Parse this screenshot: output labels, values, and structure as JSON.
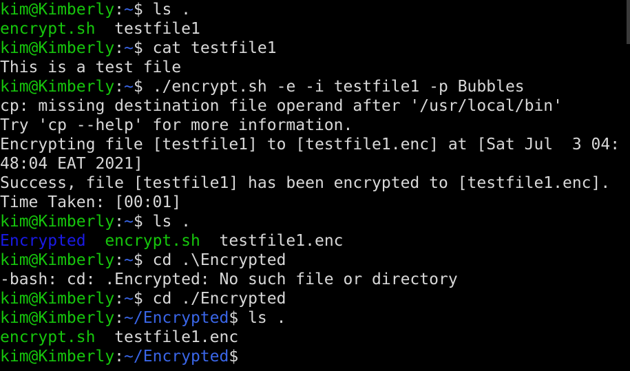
{
  "terminal": {
    "colors": {
      "background": "#000000",
      "text": "#d8d8d8",
      "prompt_user": "#16c60c",
      "prompt_path": "#3a66e8",
      "directory": "#1a1ae6",
      "executable": "#16c60c"
    },
    "prompt": {
      "userhost": "kim@Kimberly",
      "colon": ":",
      "home": "~",
      "subdir": "~/Encrypted",
      "symbol": "$"
    },
    "lines": [
      {
        "type": "prompt",
        "path": "~",
        "cmd": " ls ."
      },
      {
        "type": "listing",
        "items": [
          {
            "text": "encrypt.sh",
            "kind": "exec"
          },
          {
            "text": "  testfile1",
            "kind": "file"
          }
        ]
      },
      {
        "type": "prompt",
        "path": "~",
        "cmd": " cat testfile1"
      },
      {
        "type": "output",
        "text": "This is a test file"
      },
      {
        "type": "prompt",
        "path": "~",
        "cmd": " ./encrypt.sh -e -i testfile1 -p Bubbles"
      },
      {
        "type": "output",
        "text": "cp: missing destination file operand after '/usr/local/bin'"
      },
      {
        "type": "output",
        "text": "Try 'cp --help' for more information."
      },
      {
        "type": "output",
        "text": "Encrypting file [testfile1] to [testfile1.enc] at [Sat Jul  3 04:"
      },
      {
        "type": "output",
        "text": "48:04 EAT 2021]"
      },
      {
        "type": "output",
        "text": "Success, file [testfile1] has been encrypted to [testfile1.enc]."
      },
      {
        "type": "output",
        "text": "Time Taken: [00:01]"
      },
      {
        "type": "prompt",
        "path": "~",
        "cmd": " ls ."
      },
      {
        "type": "listing",
        "items": [
          {
            "text": "Encrypted",
            "kind": "dir"
          },
          {
            "text": "  ",
            "kind": "file"
          },
          {
            "text": "encrypt.sh",
            "kind": "exec"
          },
          {
            "text": "  testfile1.enc",
            "kind": "file"
          }
        ]
      },
      {
        "type": "prompt",
        "path": "~",
        "cmd": " cd .\\Encrypted"
      },
      {
        "type": "output",
        "text": "-bash: cd: .Encrypted: No such file or directory"
      },
      {
        "type": "prompt",
        "path": "~",
        "cmd": " cd ./Encrypted"
      },
      {
        "type": "prompt",
        "path": "~/Encrypted",
        "cmd": " ls ."
      },
      {
        "type": "listing",
        "items": [
          {
            "text": "encrypt.sh",
            "kind": "exec"
          },
          {
            "text": "  testfile1.enc",
            "kind": "file"
          }
        ]
      },
      {
        "type": "prompt",
        "path": "~/Encrypted",
        "cmd": ""
      }
    ]
  }
}
